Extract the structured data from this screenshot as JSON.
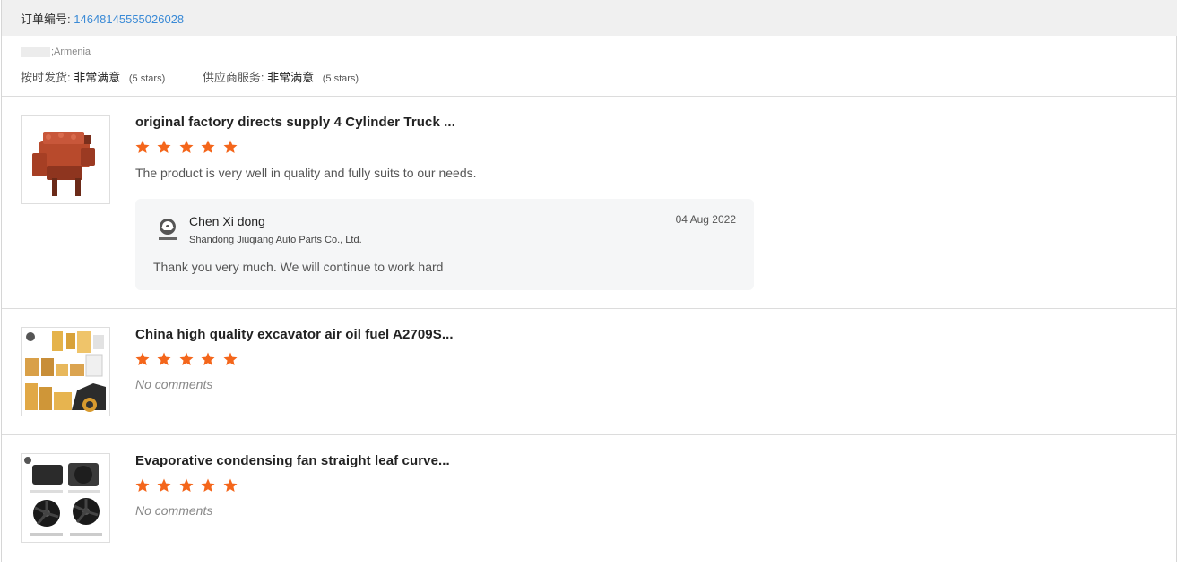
{
  "order": {
    "label": "订单编号:",
    "number": "14648145555026028"
  },
  "buyer": {
    "country": ";Armenia"
  },
  "ratings": [
    {
      "label": "按时发货:",
      "value": "非常满意",
      "stars_text": "(5 stars)"
    },
    {
      "label": "供应商服务:",
      "value": "非常满意",
      "stars_text": "(5 stars)"
    }
  ],
  "colors": {
    "star": "#f4661b",
    "accent_link": "#3a8ad6",
    "header_bg": "#f0f0f0",
    "reply_bg": "#f5f6f7"
  },
  "items": [
    {
      "thumbnail_icon": "engine-photo",
      "title": "original factory directs supply 4 Cylinder Truck ...",
      "rating": 5,
      "comment": "The product is very well in quality and fully suits to our needs.",
      "reply": {
        "logo_icon": "jiuqiang-logo",
        "name": "Chen Xi dong",
        "company": "Shandong Jiuqiang Auto Parts Co., Ltd.",
        "date": "04 Aug 2022",
        "text": "Thank you very much. We will continue to work hard"
      }
    },
    {
      "thumbnail_icon": "filters-excavator-photo",
      "title": "China high quality excavator air oil fuel A2709S...",
      "rating": 5,
      "comment": "No comments"
    },
    {
      "thumbnail_icon": "fans-photo",
      "title": "Evaporative condensing fan straight leaf curve...",
      "rating": 5,
      "comment": "No comments"
    }
  ]
}
